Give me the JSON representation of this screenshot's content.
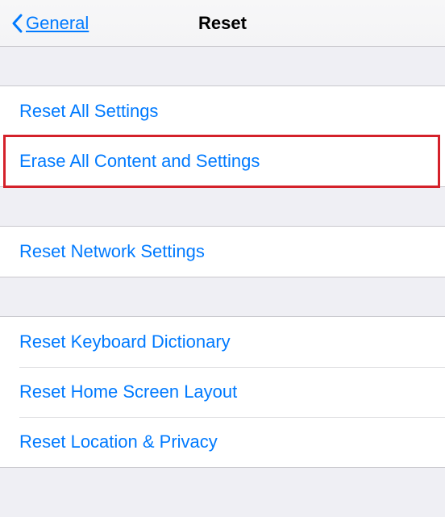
{
  "header": {
    "back_label": "General",
    "title": "Reset"
  },
  "group1": {
    "item0": "Reset All Settings",
    "item1": "Erase All Content and Settings"
  },
  "group2": {
    "item0": "Reset Network Settings"
  },
  "group3": {
    "item0": "Reset Keyboard Dictionary",
    "item1": "Reset Home Screen Layout",
    "item2": "Reset Location & Privacy"
  }
}
